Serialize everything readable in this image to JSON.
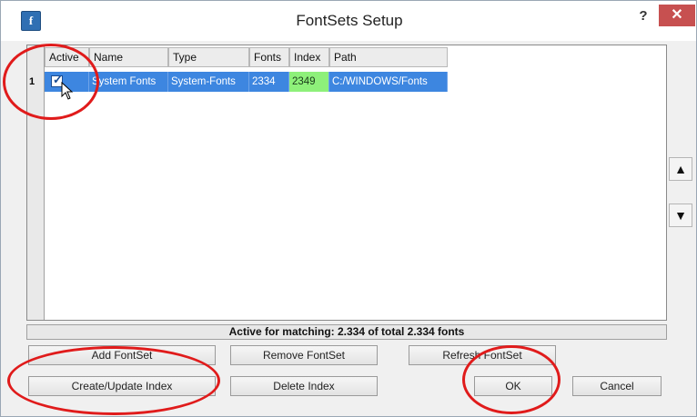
{
  "window": {
    "title": "FontSets Setup",
    "app_icon_letter": "f",
    "help_label": "?",
    "close_label": "✕"
  },
  "table": {
    "columns": [
      "Active",
      "Name",
      "Type",
      "Fonts",
      "Index",
      "Path"
    ],
    "rows": [
      {
        "number": "1",
        "active": true,
        "name": "System Fonts",
        "type": "System-Fonts",
        "fonts": "2334",
        "index": "2349",
        "path": "C:/WINDOWS/Fonts"
      }
    ]
  },
  "status": {
    "text": "Active for matching: 2.334 of total 2.334 fonts"
  },
  "buttons": {
    "add_fontset": "Add FontSet",
    "remove_fontset": "Remove FontSet",
    "refresh_fontset": "Refresh FontSet",
    "create_update_index": "Create/Update Index",
    "delete_index": "Delete Index",
    "ok": "OK",
    "cancel": "Cancel"
  },
  "side_buttons": {
    "move_up": "▲",
    "move_down": "▼"
  },
  "colors": {
    "selection": "#3d86e0",
    "index_cell": "#8ef07a",
    "annotation": "#e01b1b",
    "close_button": "#c75050"
  }
}
